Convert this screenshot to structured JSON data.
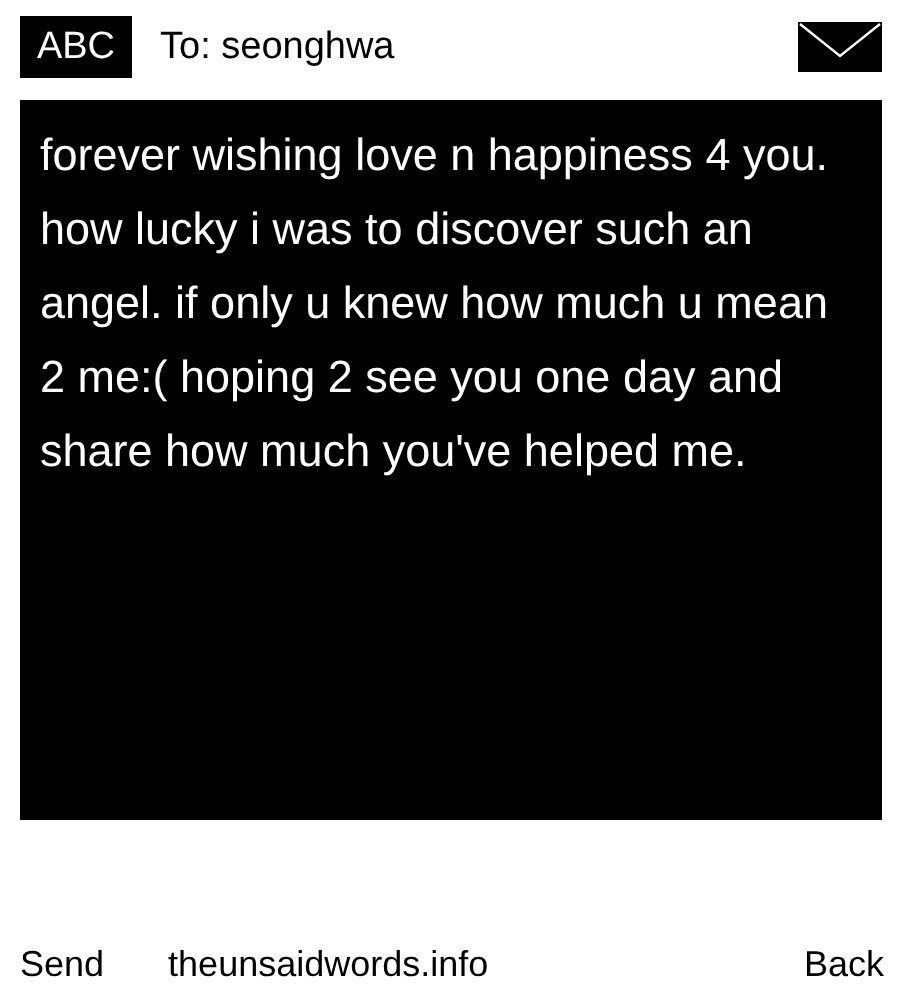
{
  "header": {
    "input_mode": "ABC",
    "recipient": "To: seonghwa"
  },
  "message": {
    "text": "forever wishing love n happiness 4 you. how lucky i was to discover such an angel. if only u knew how much u mean 2 me:( hoping 2 see you one day and share how much you've helped me."
  },
  "softkeys": {
    "left": "Send",
    "center": "theunsaidwords.info",
    "right": "Back"
  }
}
